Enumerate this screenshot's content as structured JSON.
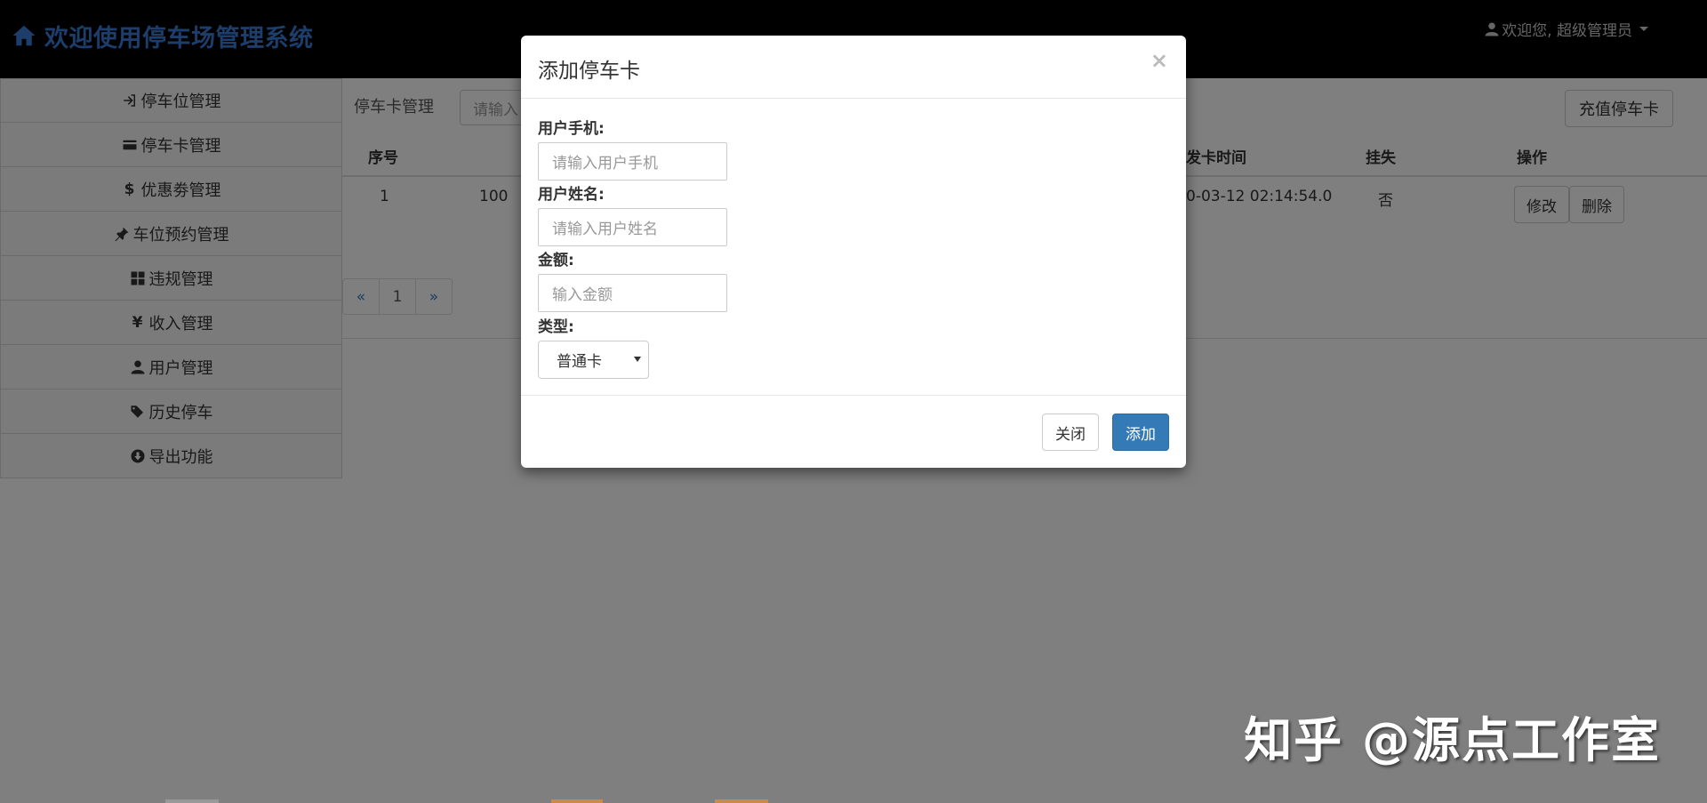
{
  "header": {
    "title": "欢迎使用停车场管理系统",
    "user_label": "欢迎您, 超级管理员"
  },
  "sidebar": {
    "items": [
      {
        "label": "停车位管理",
        "icon": "sign-in-icon"
      },
      {
        "label": "停车卡管理",
        "icon": "credit-card-icon"
      },
      {
        "label": "优惠劵管理",
        "icon": "dollar-icon"
      },
      {
        "label": "车位预约管理",
        "icon": "pushpin-icon"
      },
      {
        "label": "违规管理",
        "icon": "th-large-icon"
      },
      {
        "label": "收入管理",
        "icon": "yen-icon"
      },
      {
        "label": "用户管理",
        "icon": "user-icon"
      },
      {
        "label": "历史停车",
        "icon": "tags-icon"
      },
      {
        "label": "导出功能",
        "icon": "download-circle-icon"
      }
    ]
  },
  "main": {
    "section_label": "停车卡管理",
    "search_placeholder": "请输入",
    "recharge_label": "充值停车卡",
    "table": {
      "headers": [
        "序号",
        "发卡时间",
        "挂失",
        "操作"
      ],
      "rows": [
        {
          "index": "1",
          "card_prefix": "100",
          "issue_time": "0-03-12 02:14:54.0",
          "lost": "否"
        }
      ],
      "edit_label": "修改",
      "delete_label": "删除"
    },
    "pager": {
      "prev": "«",
      "page": "1",
      "next": "»"
    }
  },
  "modal": {
    "title": "添加停车卡",
    "close_symbol": "×",
    "phone_label": "用户手机:",
    "phone_placeholder": "请输入用户手机",
    "name_label": "用户姓名:",
    "name_placeholder": "请输入用户姓名",
    "amount_label": "金额:",
    "amount_placeholder": "输入金额",
    "type_label": "类型:",
    "type_value": "普通卡",
    "close_button": "关闭",
    "add_button": "添加"
  },
  "watermark": "知乎 @源点工作室",
  "colors": {
    "brand": "#3a7bd5",
    "primary": "#337ab7",
    "navbar": "#000000"
  }
}
